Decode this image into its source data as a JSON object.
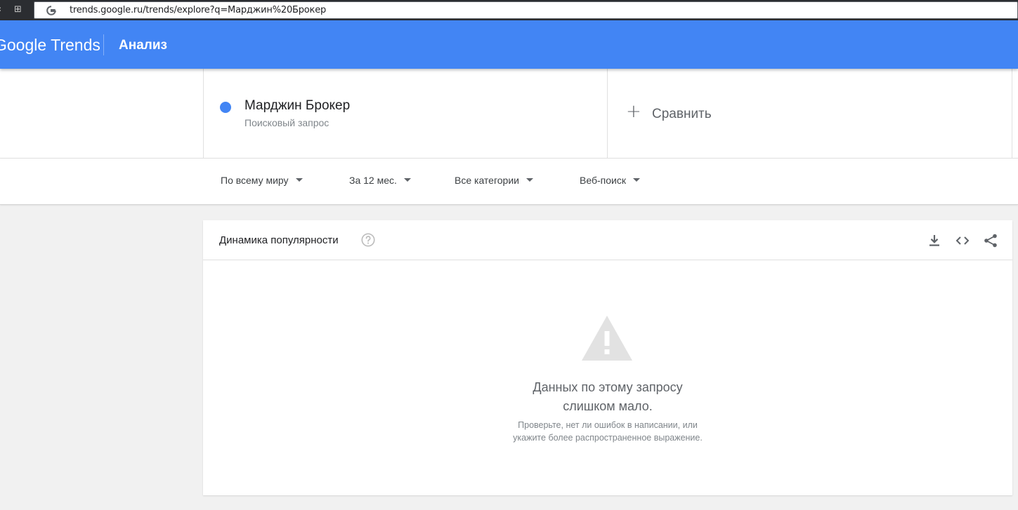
{
  "browser": {
    "url": "trends.google.ru/trends/explore?q=Марджин%20Брокер",
    "back_glyph": "‹",
    "apps_glyph": "⊞"
  },
  "header": {
    "logo_text": "Google Trends",
    "title": "Анализ",
    "background": "#4285f4"
  },
  "search_term": {
    "name": "Марджин Брокер",
    "type": "Поисковый запрос",
    "color": "#4285f4"
  },
  "compare": {
    "icon": "plus-icon",
    "label": "Сравнить"
  },
  "filters": [
    {
      "label": "По всему миру"
    },
    {
      "label": "За 12 мес."
    },
    {
      "label": "Все категории"
    },
    {
      "label": "Веб-поиск"
    }
  ],
  "card": {
    "title": "Динамика популярности",
    "icons": [
      "help-icon",
      "download-icon",
      "embed-icon",
      "share-icon"
    ],
    "message_line1": "Данных по этому запросу",
    "message_line2": "слишком мало.",
    "hint_line1": "Проверьте, нет ли ошибок в написании, или",
    "hint_line2": "укажите более распространенное выражение."
  }
}
